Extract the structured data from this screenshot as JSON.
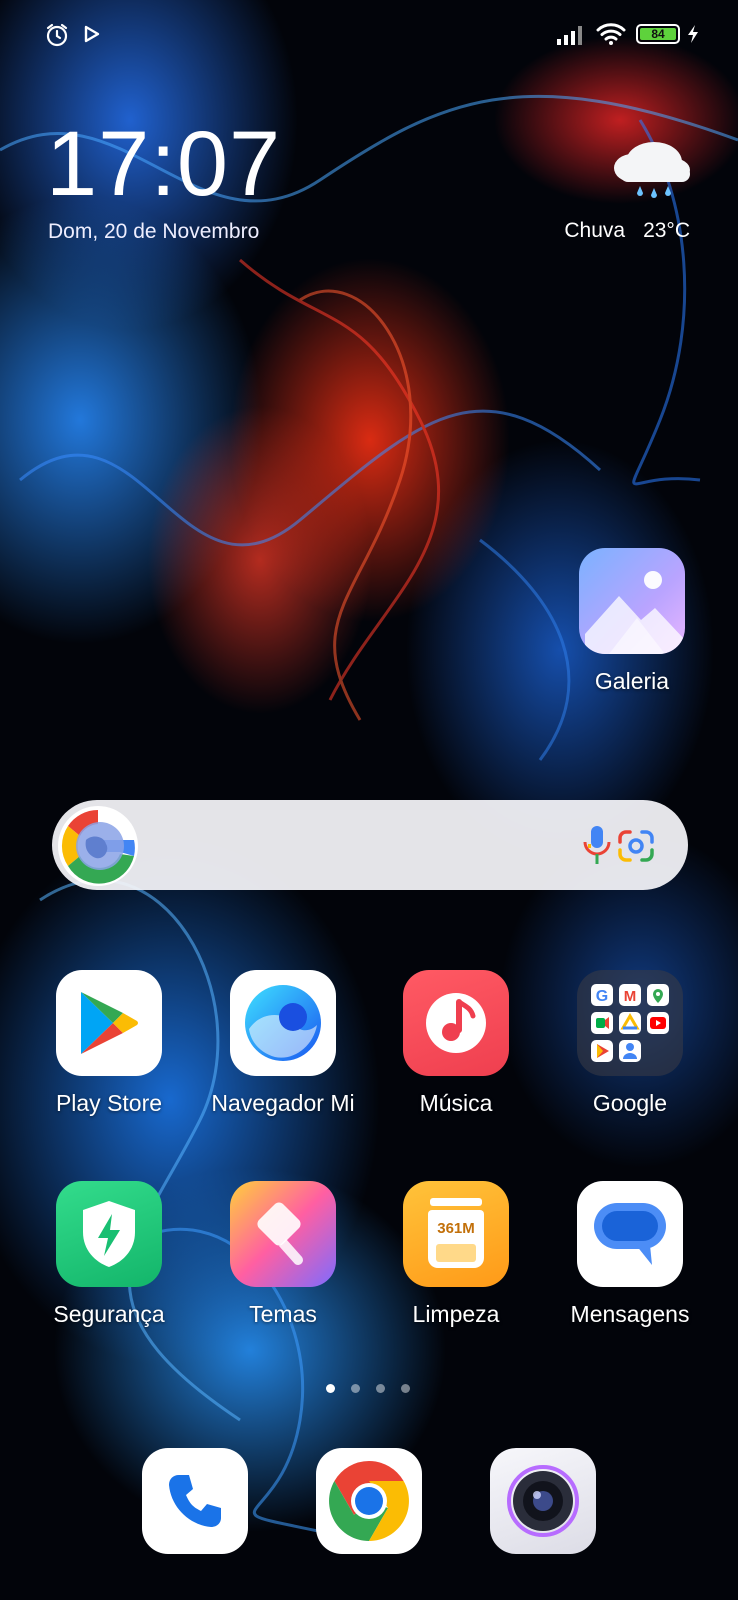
{
  "status_bar": {
    "battery_level": "84",
    "icons": [
      "alarm-icon",
      "play-icon",
      "signal-icon",
      "wifi-icon",
      "battery-icon",
      "charging-icon"
    ]
  },
  "clock_widget": {
    "time": "17:07",
    "date": "Dom, 20 de Novembro"
  },
  "weather_widget": {
    "condition": "Chuva",
    "temperature": "23°C",
    "icon": "rain-cloud-icon"
  },
  "search_bar": {
    "icons": [
      "google-logo-icon",
      "microphone-icon",
      "google-lens-icon"
    ]
  },
  "apps": {
    "galeria": "Galeria",
    "play_store": "Play Store",
    "navegador": "Navegador Mi",
    "musica": "Música",
    "google": "Google",
    "seguranca": "Segurança",
    "temas": "Temas",
    "limpeza": "Limpeza",
    "limpeza_badge": "361M",
    "mensagens": "Mensagens"
  },
  "page_indicator": {
    "pages": 4,
    "current": 1
  },
  "dock": [
    "phone-icon",
    "chrome-icon",
    "camera-icon"
  ],
  "colors": {
    "accent_blue": "#1a73e8",
    "google_red": "#ea4335",
    "google_yellow": "#fbbc04",
    "google_green": "#34a853",
    "music_red": "#ef3f4f",
    "security_green": "#1fc77a",
    "cleaner_orange": "#ffa21f"
  }
}
